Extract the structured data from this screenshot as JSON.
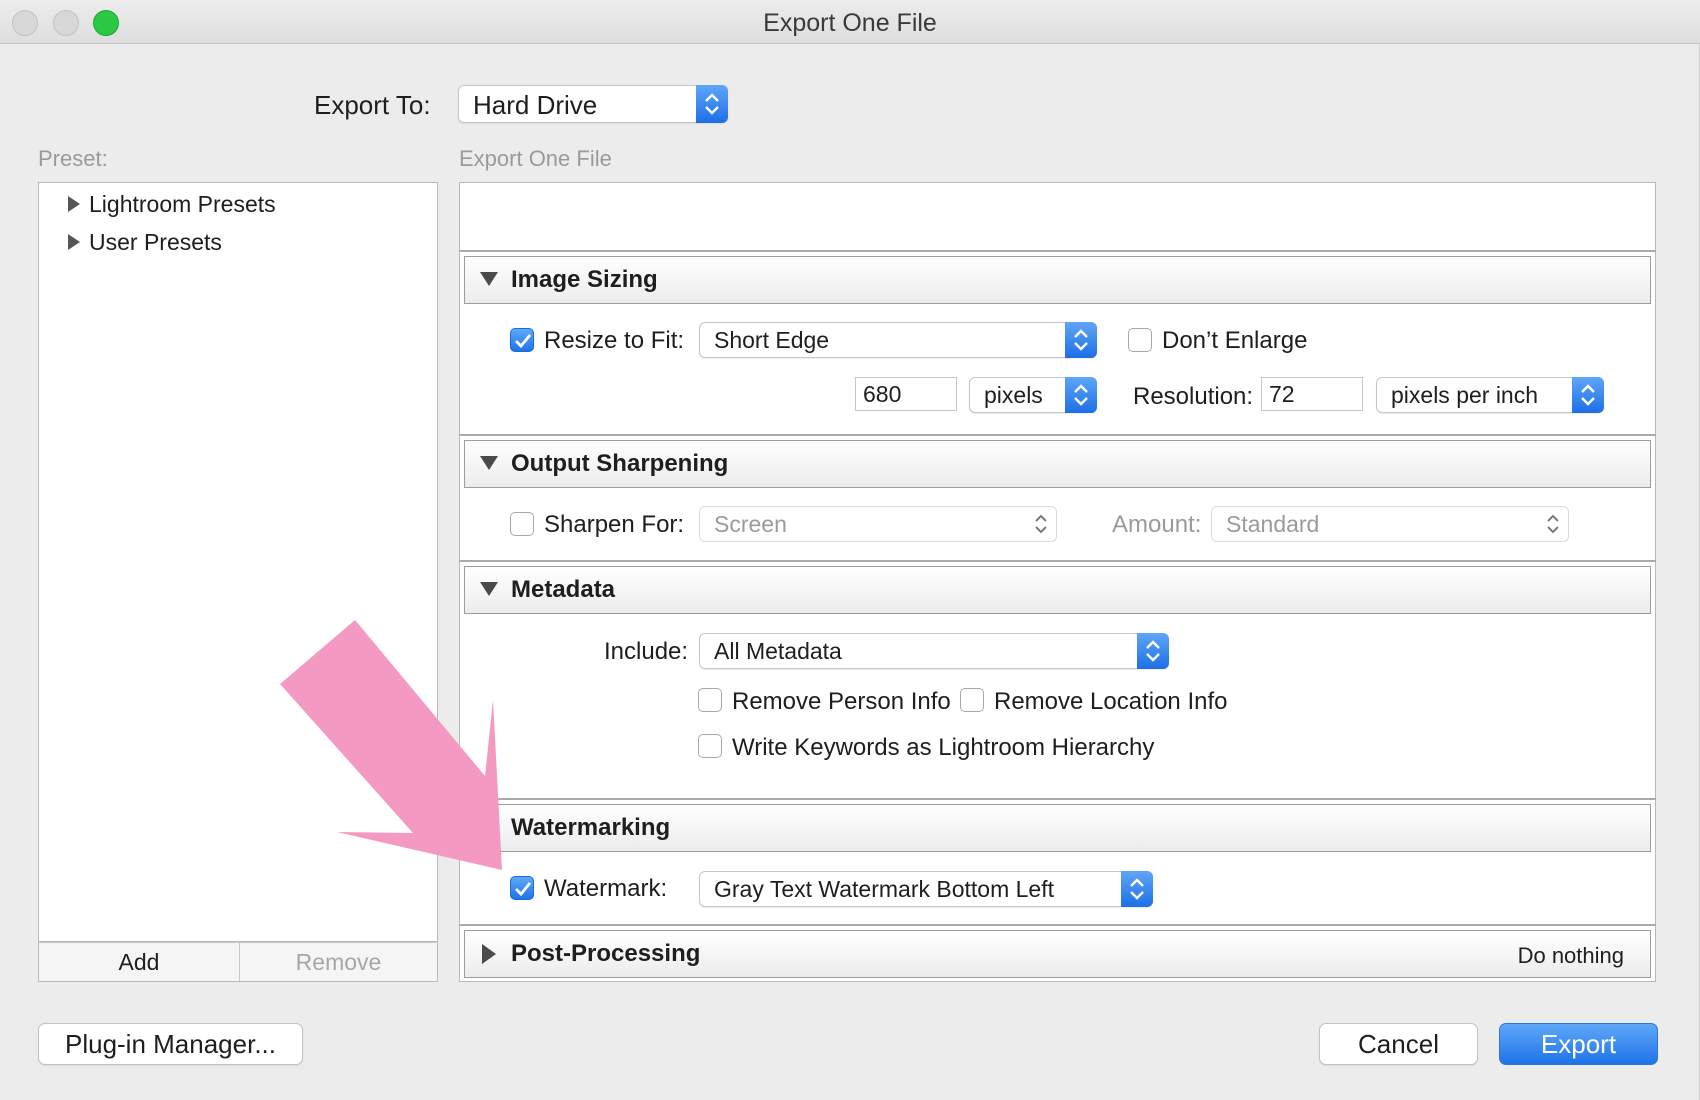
{
  "window": {
    "title": "Export One File"
  },
  "export_to": {
    "label": "Export To:",
    "value": "Hard Drive"
  },
  "preset": {
    "label": "Preset:",
    "items": [
      {
        "label": "Lightroom Presets"
      },
      {
        "label": "User Presets"
      }
    ],
    "add_label": "Add",
    "remove_label": "Remove"
  },
  "panel": {
    "heading": "Export One File"
  },
  "image_sizing": {
    "title": "Image Sizing",
    "resize_label": "Resize to Fit:",
    "resize_checked": true,
    "resize_mode": "Short Edge",
    "dont_enlarge_label": "Don’t Enlarge",
    "dont_enlarge_checked": false,
    "size_value": "680",
    "size_unit": "pixels",
    "resolution_label": "Resolution:",
    "resolution_value": "72",
    "resolution_unit": "pixels per inch"
  },
  "output_sharpening": {
    "title": "Output Sharpening",
    "sharpen_label": "Sharpen For:",
    "sharpen_checked": false,
    "sharpen_value": "Screen",
    "amount_label": "Amount:",
    "amount_value": "Standard"
  },
  "metadata": {
    "title": "Metadata",
    "include_label": "Include:",
    "include_value": "All Metadata",
    "remove_person_label": "Remove Person Info",
    "remove_location_label": "Remove Location Info",
    "write_keywords_label": "Write Keywords as Lightroom Hierarchy"
  },
  "watermarking": {
    "title": "Watermarking",
    "watermark_label": "Watermark:",
    "watermark_checked": true,
    "watermark_value": "Gray Text Watermark Bottom Left"
  },
  "post_processing": {
    "title": "Post-Processing",
    "value": "Do nothing"
  },
  "buttons": {
    "plugin_manager": "Plug-in Manager...",
    "cancel": "Cancel",
    "export": "Export"
  },
  "colors": {
    "accent": "#1f73e8",
    "annotation_arrow": "#f49ac2",
    "close_button": "#2ac845"
  },
  "annotation": {
    "icon": "pink-arrow-icon"
  }
}
